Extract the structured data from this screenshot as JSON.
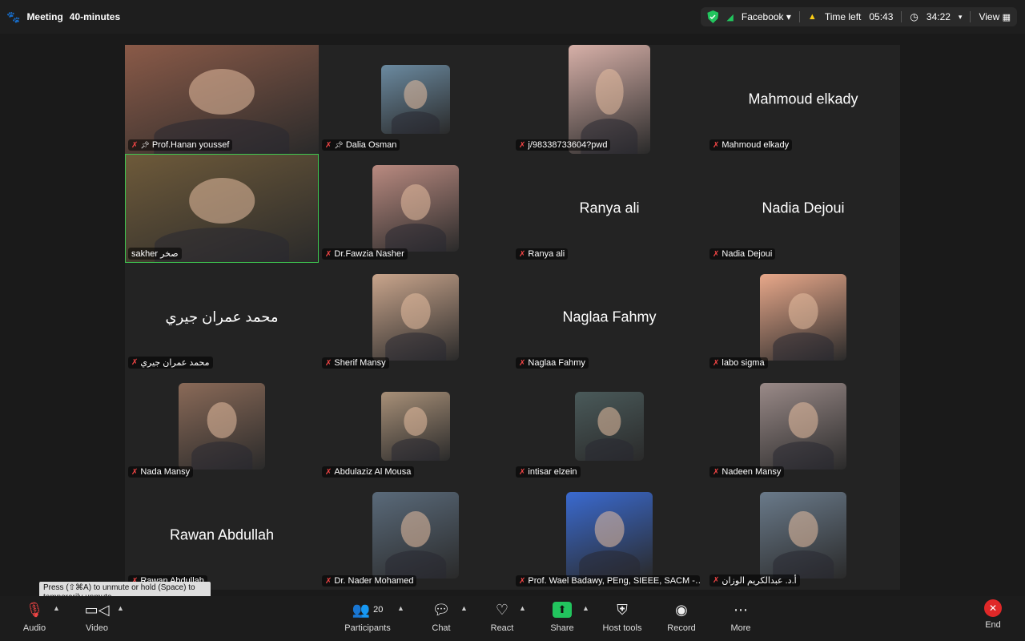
{
  "topbar": {
    "app_icon": "paw-icon",
    "meeting_label": "Meeting",
    "meeting_duration": "40-minutes",
    "source": "Facebook",
    "time_left_label": "Time left",
    "time_left": "05:43",
    "elapsed": "34:22",
    "view_label": "View"
  },
  "tiles": [
    {
      "name": "Prof.Hanan youssef",
      "pinned": true,
      "display": "video",
      "photo_bg": "#8a5a48"
    },
    {
      "name": "Dalia Osman",
      "pinned": true,
      "display": "video",
      "photo_bg": "#6b8aa0"
    },
    {
      "name": "j/98338733604?pwd",
      "pinned": false,
      "display": "video",
      "photo_bg": "#d7b0a8"
    },
    {
      "name": "Mahmoud elkady",
      "pinned": false,
      "display": "name",
      "big": "Mahmoud elkady"
    },
    {
      "name": "sakher صخر",
      "pinned": false,
      "display": "video",
      "photo_bg": "#6e5a3a",
      "active": true
    },
    {
      "name": "Dr.Fawzia Nasher",
      "pinned": false,
      "display": "video",
      "photo_bg": "#b98a80"
    },
    {
      "name": "Ranya ali",
      "pinned": false,
      "display": "name",
      "big": "Ranya ali"
    },
    {
      "name": "Nadia Dejoui",
      "pinned": false,
      "display": "name",
      "big": "Nadia Dejoui"
    },
    {
      "name": "محمد عمران جيري",
      "pinned": false,
      "display": "name",
      "big": "محمد عمران جيري"
    },
    {
      "name": "Sherif Mansy",
      "pinned": false,
      "display": "video",
      "photo_bg": "#c9a58c"
    },
    {
      "name": "Naglaa Fahmy",
      "pinned": false,
      "display": "name",
      "big": "Naglaa Fahmy"
    },
    {
      "name": "labo sigma",
      "pinned": false,
      "display": "video",
      "photo_bg": "#e8a88a"
    },
    {
      "name": "Nada Mansy",
      "pinned": false,
      "display": "video",
      "photo_bg": "#8a6a58"
    },
    {
      "name": "Abdulaziz Al Mousa",
      "pinned": false,
      "display": "video",
      "photo_bg": "#a89078"
    },
    {
      "name": "intisar elzein",
      "pinned": false,
      "display": "video",
      "photo_bg": "#4a5a5a"
    },
    {
      "name": "Nadeen Mansy",
      "pinned": false,
      "display": "video",
      "photo_bg": "#9a8a88"
    },
    {
      "name": "Rawan Abdullah",
      "pinned": false,
      "display": "name",
      "big": "Rawan Abdullah"
    },
    {
      "name": "Dr. Nader Mohamed",
      "pinned": false,
      "display": "video",
      "photo_bg": "#5a6a7a"
    },
    {
      "name": "Prof. Wael Badawy, PEng, SIEEE, SACM -…",
      "pinned": false,
      "display": "video",
      "photo_bg": "#3a6ad0"
    },
    {
      "name": "أ.د. عبدالكريم الوزان",
      "pinned": false,
      "display": "video",
      "photo_bg": "#6a7a8a"
    }
  ],
  "tooltip": "Press (⇧⌘A) to unmute or hold (Space) to temporarily unmute.",
  "toolbar": {
    "audio": "Audio",
    "video": "Video",
    "participants": "Participants",
    "participants_count": "20",
    "chat": "Chat",
    "react": "React",
    "share": "Share",
    "host_tools": "Host tools",
    "record": "Record",
    "more": "More",
    "end": "End"
  }
}
